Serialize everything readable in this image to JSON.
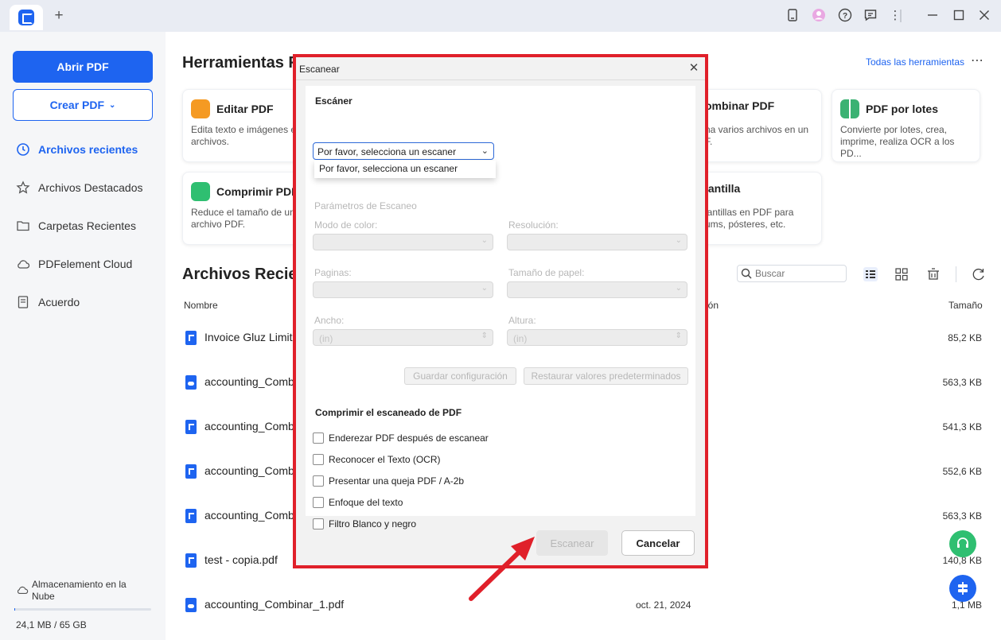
{
  "app": {
    "icons": [
      "pdfelement-logo-icon",
      "new-tab-icon",
      "book-icon",
      "avatar",
      "help-icon",
      "feedback-icon",
      "more-icon",
      "minimize-icon",
      "maximize-icon",
      "close-icon"
    ]
  },
  "sidebar": {
    "open_pdf": "Abrir PDF",
    "create_pdf": "Crear PDF",
    "items": [
      {
        "label": "Archivos recientes",
        "icon": "clock-icon",
        "active": true
      },
      {
        "label": "Archivos Destacados",
        "icon": "star-icon",
        "active": false
      },
      {
        "label": "Carpetas Recientes",
        "icon": "folder-icon",
        "active": false
      },
      {
        "label": "PDFelement Cloud",
        "icon": "cloud-icon",
        "active": false
      },
      {
        "label": "Acuerdo",
        "icon": "document-icon",
        "active": false
      }
    ],
    "storage_label": "Almacenamiento en la Nube",
    "storage_size": "24,1 MB / 65 GB",
    "storage_used_fraction": 0.0004
  },
  "tools": {
    "title": "Herramientas R",
    "all_tools": "Todas las herramientas",
    "cards": [
      {
        "title": "Editar PDF",
        "desc": "Edita texto e imágenes e archivos.",
        "color": "#f59a23"
      },
      {
        "title": "ombinar PDF",
        "desc": "na varios archivos en un F.",
        "color": "#7c5cf5"
      },
      {
        "title": "PDF por lotes",
        "desc": "Convierte por lotes, crea, imprime, realiza OCR a los PD...",
        "color": "#3bb273"
      },
      {
        "title": "Comprimir PDF",
        "desc": "Reduce el tamaño de un archivo PDF.",
        "color": "#2fbf71"
      },
      {
        "title": "lantilla",
        "desc": "lantillas en PDF para ums, pósteres, etc.",
        "color": "#1e64f0"
      }
    ]
  },
  "recent": {
    "title": "Archivos Recien",
    "search_placeholder": "Buscar",
    "col_name": "Nombre",
    "col_date": "ción",
    "col_size": "Tamaño",
    "files": [
      {
        "name": "Invoice Gluz Limite",
        "date": "",
        "size": "85,2 KB",
        "type": "pdf"
      },
      {
        "name": "accounting_Comb",
        "date": "",
        "size": "563,3 KB",
        "type": "cloud"
      },
      {
        "name": "accounting_Comb",
        "date": "",
        "size": "541,3 KB",
        "type": "pdf"
      },
      {
        "name": "accounting_Comb",
        "date": "",
        "size": "552,6 KB",
        "type": "pdf"
      },
      {
        "name": "accounting_Comb",
        "date": "",
        "size": "563,3 KB",
        "type": "pdf"
      },
      {
        "name": "test - copia.pdf",
        "date": "",
        "size": "140,8 KB",
        "type": "pdf"
      },
      {
        "name": "accounting_Combinar_1.pdf",
        "date": "oct. 21, 2024",
        "size": "1,1 MB",
        "type": "cloud"
      }
    ]
  },
  "dialog": {
    "title": "Escanear",
    "scanner_label": "Escáner",
    "scanner_value": "Por favor, selecciona un escaner",
    "scanner_option": "Por favor, selecciona un escaner",
    "params_label": "Parámetros de Escaneo",
    "color_mode": "Modo de color:",
    "resolution": "Resolución:",
    "pages": "Paginas:",
    "paper_size": "Tamaño de papel:",
    "width": "Ancho:",
    "height": "Altura:",
    "unit": "(in)",
    "save_config": "Guardar configuración",
    "restore_defaults": "Restaurar valores predeterminados",
    "compress_label": "Comprimir el escaneado de PDF",
    "options": [
      "Enderezar PDF después de escanear",
      "Reconocer el Texto (OCR)",
      "Presentar una queja PDF / A-2b",
      "Enfoque del texto",
      "Filtro Blanco y negro"
    ],
    "scan": "Escanear",
    "cancel": "Cancelar"
  },
  "colors": {
    "accent": "#1e64f0",
    "highlight_frame": "#e0202a",
    "support": "#2fbf71"
  }
}
